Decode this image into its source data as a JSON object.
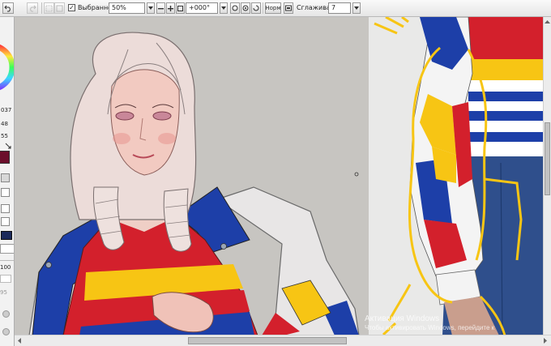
{
  "toolbar": {
    "selection_checkbox_checked": true,
    "selection_label": "Выбранное",
    "zoom_value": "50%",
    "rotation_value": "+000°",
    "blend_mode": "Норм",
    "smoothing_label": "Сглаживание",
    "smoothing_value": "7",
    "buttons": [
      "undo",
      "redo",
      "zoom-out",
      "zoom-reset",
      "zoom-in",
      "rotate-left",
      "rotate-reset",
      "rotate-right",
      "flip-horizontal",
      "fit-window"
    ]
  },
  "left_panel": {
    "values": [
      "037",
      "48",
      "55"
    ],
    "brush_size_value": "100",
    "brush_density_value": "95",
    "main_color": "#6b0f2b",
    "secondary_color": "#ffffff",
    "color_wheel": "hsv-wheel"
  },
  "canvas": {
    "background": "#c7c5c1",
    "artwork": "portrait-drawing",
    "reference": "reference-photo"
  },
  "watermark": {
    "line1": "Активация Windows",
    "line2": "Чтобы активировать Windows, перейдите к"
  },
  "colors": {
    "red": "#d3202c",
    "blue": "#1d3fa8",
    "yellow": "#f7c514",
    "hair": "#eddcd9",
    "skin": "#f0c9c0"
  }
}
